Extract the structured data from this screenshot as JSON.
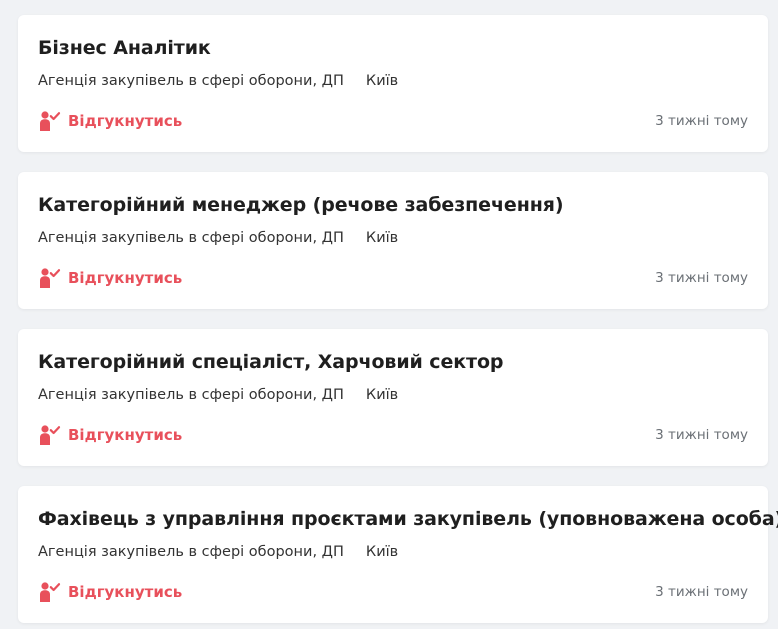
{
  "colors": {
    "accent": "#e8505b",
    "background": "#f0f2f5",
    "card": "#ffffff"
  },
  "vacancies": [
    {
      "title": "Бізнес Аналітик",
      "company": "Агенція закупівель в сфері оборони, ДП",
      "city": "Київ",
      "apply_label": "Відгукнутись",
      "apply_icon": "person-check-icon",
      "posted": "3 тижні тому"
    },
    {
      "title": "Категорійний менеджер (речове забезпечення)",
      "company": "Агенція закупівель в сфері оборони, ДП",
      "city": "Київ",
      "apply_label": "Відгукнутись",
      "apply_icon": "person-check-icon",
      "posted": "3 тижні тому"
    },
    {
      "title": "Категорійний спеціаліст, Харчовий сектор",
      "company": "Агенція закупівель в сфері оборони, ДП",
      "city": "Київ",
      "apply_label": "Відгукнутись",
      "apply_icon": "person-check-icon",
      "posted": "3 тижні тому"
    },
    {
      "title": "Фахівець з управління проєктами закупівель (уповноважена особа)",
      "company": "Агенція закупівель в сфері оборони, ДП",
      "city": "Київ",
      "apply_label": "Відгукнутись",
      "apply_icon": "person-check-icon",
      "posted": "3 тижні тому"
    }
  ]
}
